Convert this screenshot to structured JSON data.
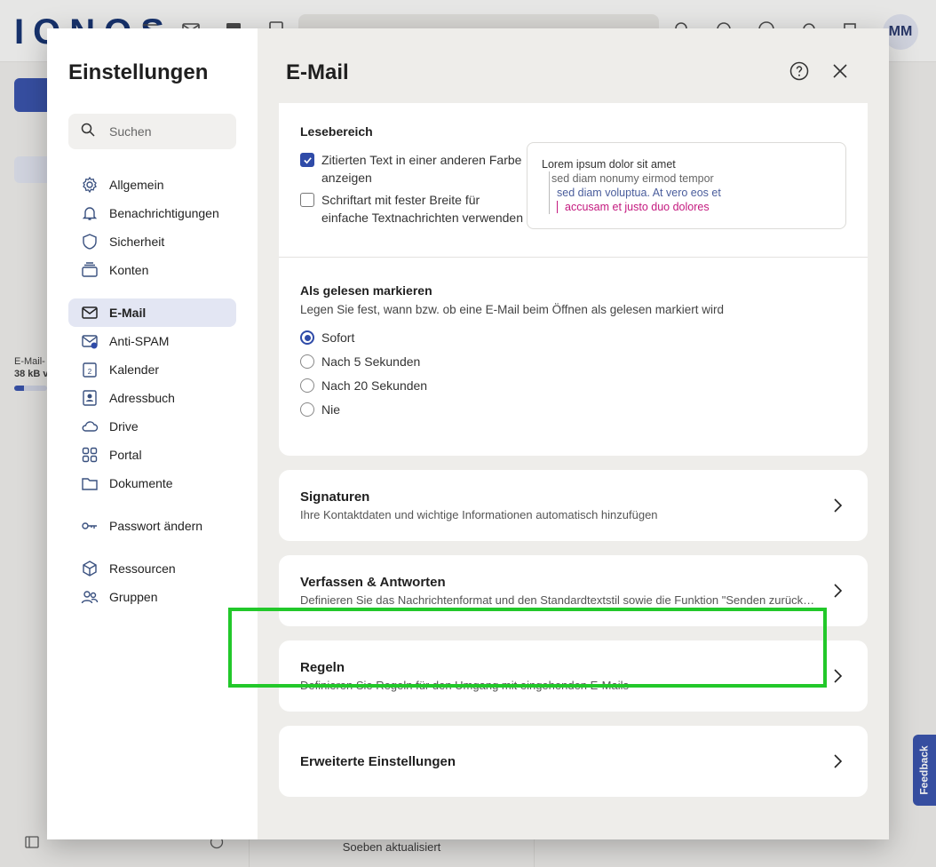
{
  "app": {
    "logo": "IONOS",
    "avatar_initials": "MM",
    "quota_label_1": "E-Mail-",
    "quota_label_2": "38 kB v",
    "quota_fraction": 0.3,
    "status_text": "Soeben aktualisiert",
    "feedback_label": "Feedback"
  },
  "nav": {
    "title": "Einstellungen",
    "search_placeholder": "Suchen",
    "items": [
      {
        "label": "Allgemein",
        "icon": "gear-icon"
      },
      {
        "label": "Benachrichtigungen",
        "icon": "bell-icon"
      },
      {
        "label": "Sicherheit",
        "icon": "shield-icon"
      },
      {
        "label": "Konten",
        "icon": "accounts-icon"
      },
      {
        "label": "E-Mail",
        "icon": "mail-icon",
        "active": true
      },
      {
        "label": "Anti-SPAM",
        "icon": "antispam-icon"
      },
      {
        "label": "Kalender",
        "icon": "calendar-icon",
        "calendar_day": "2"
      },
      {
        "label": "Adressbuch",
        "icon": "addressbook-icon"
      },
      {
        "label": "Drive",
        "icon": "cloud-icon"
      },
      {
        "label": "Portal",
        "icon": "grid-icon"
      },
      {
        "label": "Dokumente",
        "icon": "folder-icon"
      },
      {
        "label": "Passwort ändern",
        "icon": "key-icon"
      },
      {
        "label": "Ressourcen",
        "icon": "cube-icon"
      },
      {
        "label": "Gruppen",
        "icon": "group-icon"
      }
    ]
  },
  "content": {
    "title": "E-Mail",
    "reading_pane": {
      "title": "Lesebereich",
      "opt1_line1": "Zitierten Text in einer anderen Farbe",
      "opt1_line2": "anzeigen",
      "opt1_checked": true,
      "opt2_line1": "Schriftart mit fester Breite für",
      "opt2_line2": "einfache Textnachrichten verwenden",
      "opt2_checked": false,
      "preview": [
        "Lorem ipsum dolor sit amet",
        "sed diam nonumy eirmod tempor",
        "sed diam voluptua. At vero eos et",
        "accusam et justo duo dolores"
      ]
    },
    "mark_read": {
      "title": "Als gelesen markieren",
      "description": "Legen Sie fest, wann bzw. ob eine E-Mail beim Öffnen als gelesen markiert wird",
      "options": [
        "Sofort",
        "Nach 5 Sekunden",
        "Nach 20 Sekunden",
        "Nie"
      ],
      "selected": "Sofort"
    },
    "cards": [
      {
        "title": "Signaturen",
        "description": "Ihre Kontaktdaten und wichtige Informationen automatisch hinzufügen"
      },
      {
        "title": "Verfassen & Antworten",
        "description": "Definieren Sie das Nachrichtenformat und den Standardtextstil sowie die Funktion \"Senden zurücknehmen\""
      },
      {
        "title": "Regeln",
        "description": "Definieren Sie Regeln für den Umgang mit eingehenden E-Mails",
        "highlighted": true
      },
      {
        "title": "Erweiterte Einstellungen",
        "description": ""
      }
    ]
  },
  "colors": {
    "accent": "#2f4ba8",
    "highlight": "#22c82a",
    "quote_level_4": "#c41a7f"
  }
}
